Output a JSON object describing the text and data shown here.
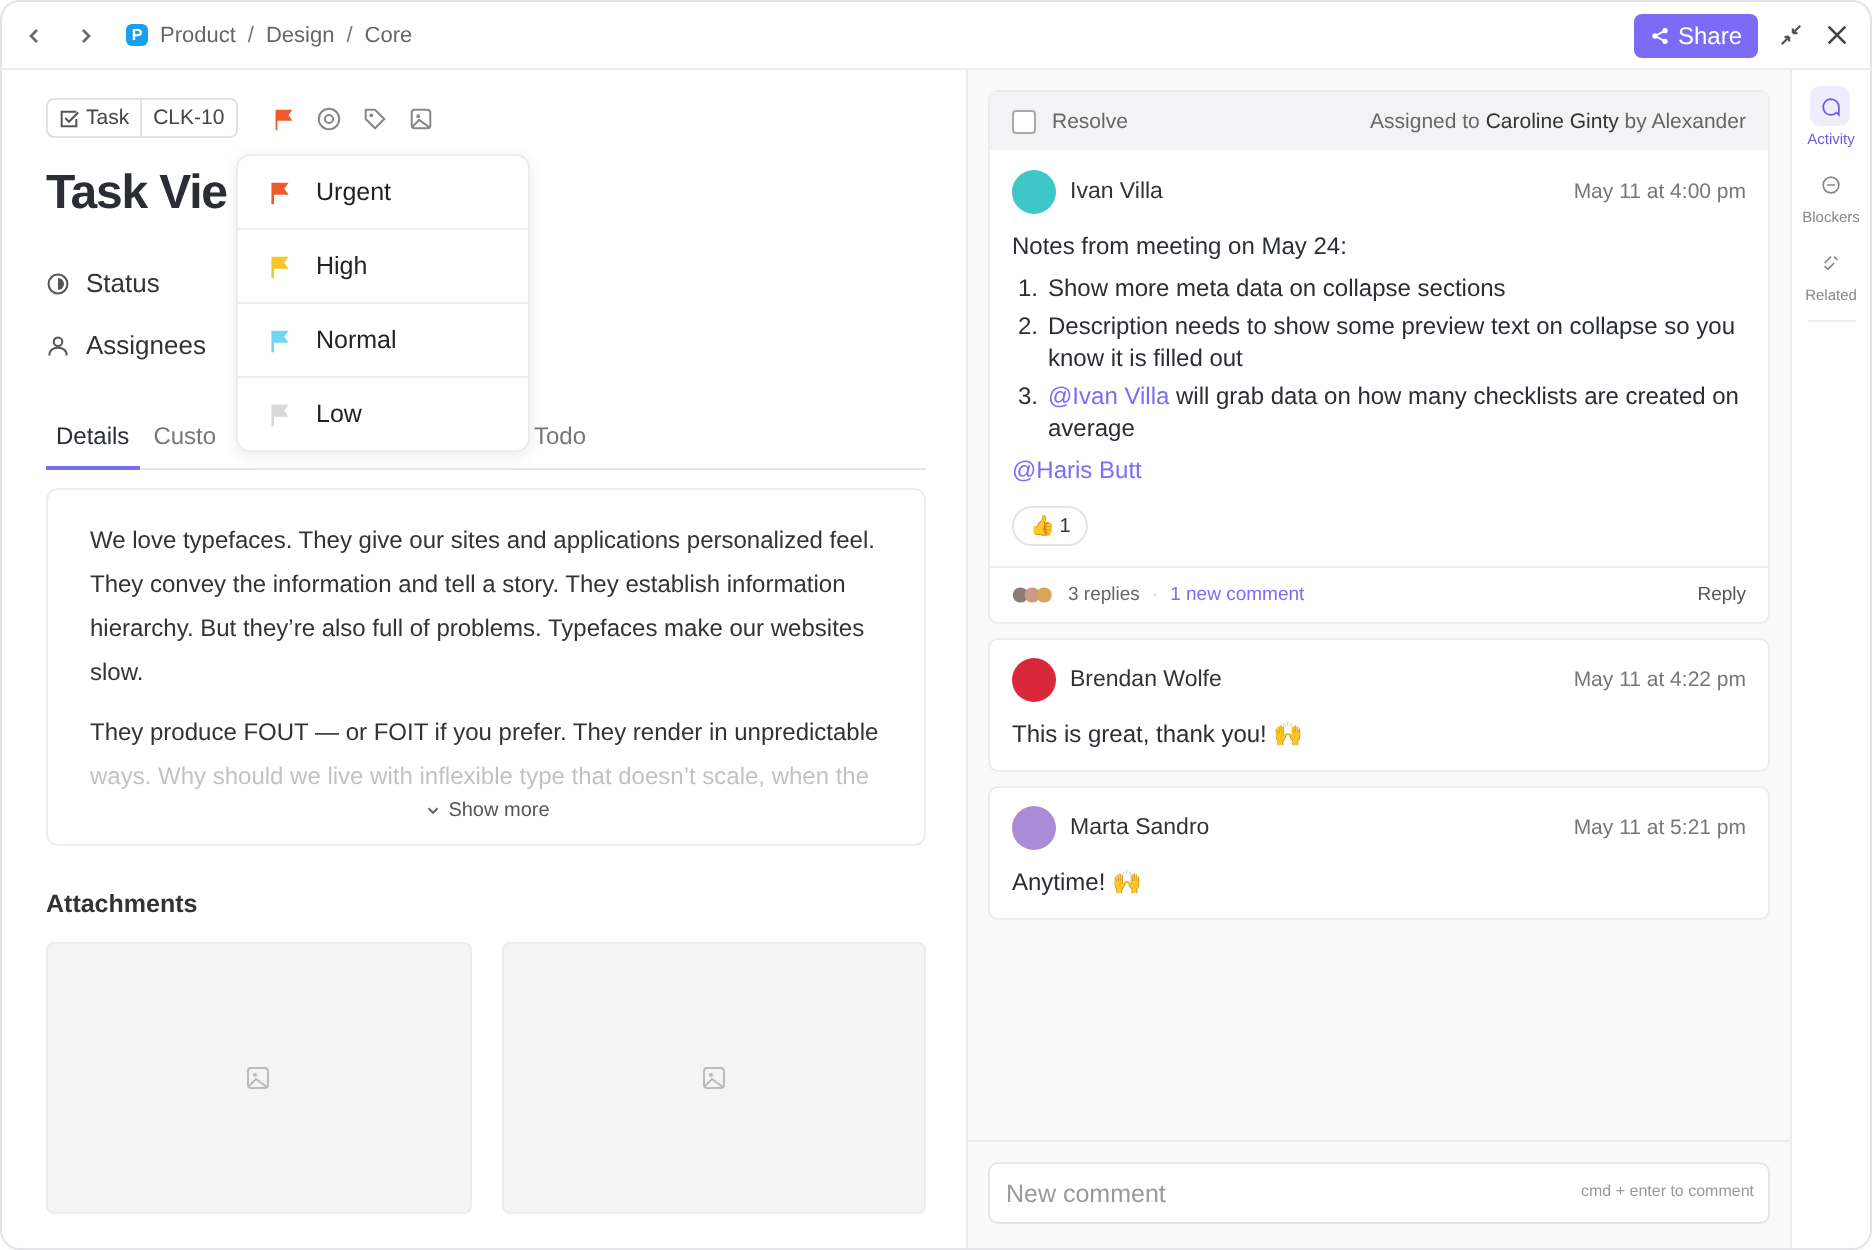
{
  "topbar": {
    "breadcrumbs": [
      "Product",
      "Design",
      "Core"
    ],
    "space_letter": "P",
    "separator": "/",
    "share_label": "Share"
  },
  "task": {
    "type_label": "Task",
    "id": "CLK-10",
    "title": "Task Vie",
    "fields": [
      {
        "kind": "status",
        "label": "Status"
      },
      {
        "kind": "assignees",
        "label": "Assignees"
      }
    ]
  },
  "priority_menu": [
    {
      "label": "Urgent",
      "color": "#f0592a"
    },
    {
      "label": "High",
      "color": "#f5c62a"
    },
    {
      "label": "Normal",
      "color": "#72d6f0"
    },
    {
      "label": "Low",
      "color": "#d8d8d8"
    }
  ],
  "tabs": [
    {
      "label": "Details",
      "selected": true
    },
    {
      "label": "Custo",
      "selected": false
    },
    {
      "label": "Todo",
      "selected": false
    }
  ],
  "description": {
    "paragraphs": [
      "We love typefaces. They give our sites and applications personalized feel. They convey the information and tell a story. They establish information hierarchy. But they’re also full of problems. Typefaces make our websites slow.",
      "They produce FOUT — or FOIT if you prefer. They render in unpredictable ways. Why should we live with inflexible type that doesn’t scale, when the"
    ],
    "show_more": "Show more"
  },
  "attachments": {
    "title": "Attachments"
  },
  "thread": {
    "resolve_label": "Resolve",
    "resolved": false,
    "assigned": "Assigned to **Caroline Ginty** by Alexander",
    "comment": {
      "author": "Ivan Villa",
      "color": "#3ec7c9",
      "time": "May 11 at 4:00 pm",
      "intro": "Notes from meeting on May 24:",
      "items": [
        {
          "marker": "1.",
          "text": "Show more meta data on collapse sections"
        },
        {
          "marker": "2.",
          "text": "Description needs to show some preview text on collapse so you know it is filled out"
        },
        {
          "marker": "3.",
          "mention": "@Ivan Villa",
          "text": " will grab data on how many checklists are created on average"
        }
      ],
      "mention": "@Haris Butt",
      "reaction": "👍",
      "reaction_count": "1"
    },
    "replies": "3 replies",
    "separator": "·",
    "new_comments": "1 new comment",
    "reply_label": "Reply"
  },
  "comments": [
    {
      "author": "Brendan Wolfe",
      "color": "#d9283a",
      "time": "May 11 at 4:22 pm",
      "text": "This is great, thank you! 🙌"
    },
    {
      "author": "Marta Sandro",
      "color": "#a98bd6",
      "time": "May 11 at 5:21 pm",
      "text": "Anytime! 🙌"
    }
  ],
  "comment_box": {
    "placeholder": "New comment",
    "hint": "cmd + enter to comment"
  },
  "side_tabs": [
    {
      "kind": "activity",
      "label": "Activity",
      "selected": true
    },
    {
      "kind": "blockers",
      "label": "Blockers",
      "selected": false
    },
    {
      "kind": "related",
      "label": "Related",
      "selected": false
    }
  ]
}
